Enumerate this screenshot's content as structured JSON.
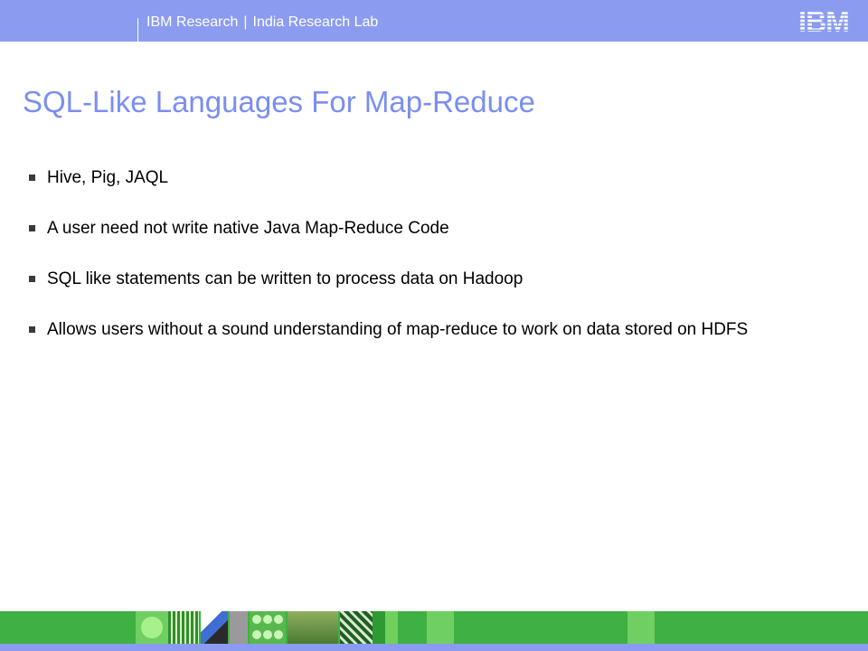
{
  "header": {
    "org": "IBM Research",
    "separator": "|",
    "lab": "India Research Lab",
    "logo_text": "IBM"
  },
  "slide": {
    "title": "SQL-Like Languages For Map-Reduce",
    "bullets": [
      "Hive, Pig, JAQL",
      "A user need not write native Java Map-Reduce Code",
      "SQL like statements can be written to process data on Hadoop",
      "Allows users without a sound understanding of map-reduce to work on data stored on HDFS"
    ]
  },
  "colors": {
    "header_bar": "#8b9cf0",
    "title": "#7b8ef0",
    "footer_bar": "#3fb043"
  }
}
